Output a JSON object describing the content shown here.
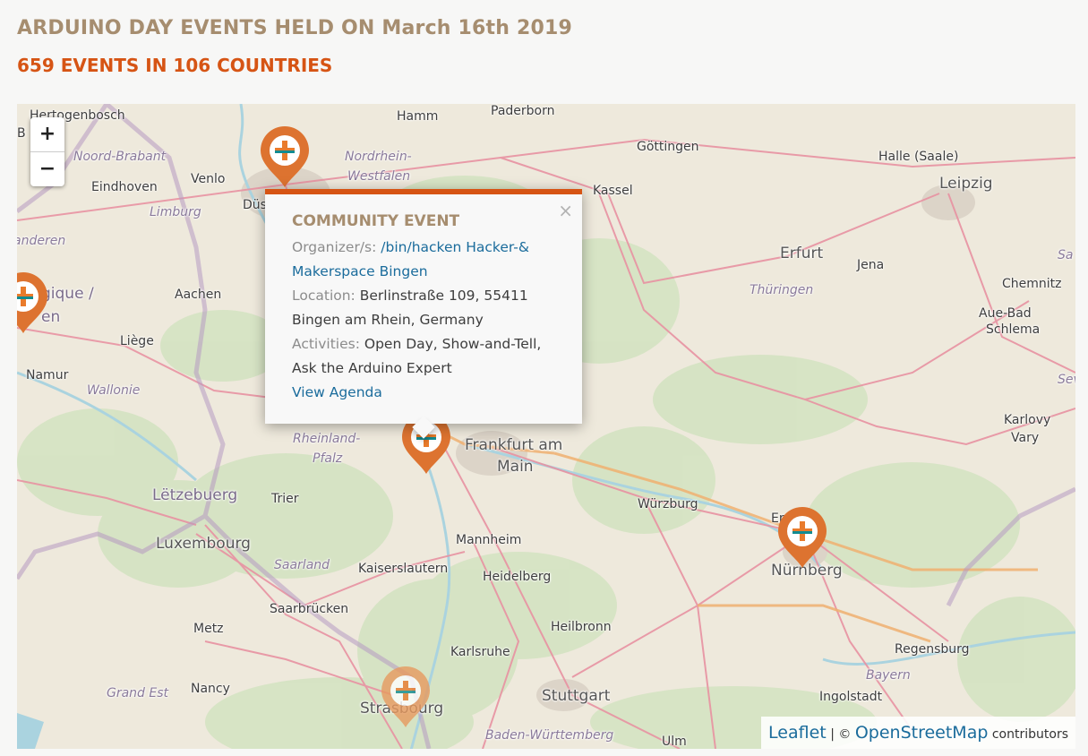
{
  "header": {
    "title": "ARDUINO DAY EVENTS HELD ON March 16th 2019",
    "subtitle": "659 EVENTS IN 106 COUNTRIES"
  },
  "map": {
    "zoom_in": "+",
    "zoom_out": "−",
    "places": [
      {
        "name": "Hertogenbosch",
        "type": "city"
      },
      {
        "name": "Hamm",
        "type": "city"
      },
      {
        "name": "Paderborn",
        "type": "city"
      },
      {
        "name": "Noord-Brabant",
        "type": "region"
      },
      {
        "name": "Nordrhein-",
        "type": "region"
      },
      {
        "name": "Westfalen",
        "type": "region"
      },
      {
        "name": "Göttingen",
        "type": "city"
      },
      {
        "name": "Halle (Saale)",
        "type": "city"
      },
      {
        "name": "Venlo",
        "type": "city"
      },
      {
        "name": "Eindhoven",
        "type": "city"
      },
      {
        "name": "Kassel",
        "type": "city"
      },
      {
        "name": "Leipzig",
        "type": "big"
      },
      {
        "name": "Limburg",
        "type": "region"
      },
      {
        "name": "Düs",
        "type": "city"
      },
      {
        "name": "anderen",
        "type": "region"
      },
      {
        "name": "Erfurt",
        "type": "big"
      },
      {
        "name": "Jena",
        "type": "city"
      },
      {
        "name": "Sa",
        "type": "region"
      },
      {
        "name": "Chemnitz",
        "type": "city"
      },
      {
        "name": "Aachen",
        "type": "city"
      },
      {
        "name": "Thüringen",
        "type": "region"
      },
      {
        "name": "gique /",
        "type": "country"
      },
      {
        "name": "en",
        "type": "country"
      },
      {
        "name": "Aue-Bad",
        "type": "city"
      },
      {
        "name": "Schlema",
        "type": "city"
      },
      {
        "name": "Liège",
        "type": "city"
      },
      {
        "name": "Namur",
        "type": "city"
      },
      {
        "name": "Wallonie",
        "type": "region"
      },
      {
        "name": "Sev",
        "type": "region"
      },
      {
        "name": "Karlovy",
        "type": "city"
      },
      {
        "name": "Vary",
        "type": "city"
      },
      {
        "name": "Rheinland-",
        "type": "region"
      },
      {
        "name": "Pfalz",
        "type": "region"
      },
      {
        "name": "Frankfurt am",
        "type": "big"
      },
      {
        "name": "Main",
        "type": "big"
      },
      {
        "name": "Lëtzebuerg",
        "type": "country"
      },
      {
        "name": "Trier",
        "type": "city"
      },
      {
        "name": "Würzburg",
        "type": "city"
      },
      {
        "name": "Luxembourg",
        "type": "big"
      },
      {
        "name": "Mannheim",
        "type": "city"
      },
      {
        "name": "Saarland",
        "type": "region"
      },
      {
        "name": "Kaiserslautern",
        "type": "city"
      },
      {
        "name": "Heidelberg",
        "type": "city"
      },
      {
        "name": "Nürnberg",
        "type": "big"
      },
      {
        "name": "Er",
        "type": "city"
      },
      {
        "name": "Saarbrücken",
        "type": "city"
      },
      {
        "name": "Metz",
        "type": "city"
      },
      {
        "name": "Heilbronn",
        "type": "city"
      },
      {
        "name": "Regensburg",
        "type": "city"
      },
      {
        "name": "Karlsruhe",
        "type": "city"
      },
      {
        "name": "Bayern",
        "type": "region"
      },
      {
        "name": "Grand Est",
        "type": "region"
      },
      {
        "name": "Nancy",
        "type": "city"
      },
      {
        "name": "Stuttgart",
        "type": "big"
      },
      {
        "name": "Ingolstadt",
        "type": "city"
      },
      {
        "name": "Strasbourg",
        "type": "big"
      },
      {
        "name": "Baden-Württemberg",
        "type": "region"
      },
      {
        "name": "Ulm",
        "type": "city"
      },
      {
        "name": "B",
        "type": "city"
      }
    ],
    "marker_colors": {
      "pin": "#dd7330",
      "pin_faded": "#e79a5f",
      "cross_orange": "#e97b2c",
      "cross_teal": "#138b91"
    }
  },
  "popup": {
    "title": "COMMUNITY EVENT",
    "organizer_label": "Organizer/s:",
    "organizer_value": "/bin/hacken Hacker-& Makerspace Bingen",
    "location_label": "Location:",
    "location_value": "Berlinstraße 109, 55411 Bingen am Rhein, Germany",
    "activities_label": "Activities:",
    "activities_value": "Open Day, Show-and-Tell, Ask the Arduino Expert",
    "agenda_link": "View Agenda",
    "close": "×"
  },
  "attribution": {
    "leaflet": "Leaflet",
    "separator": " | © ",
    "osm": "OpenStreetMap",
    "suffix": " contributors"
  }
}
